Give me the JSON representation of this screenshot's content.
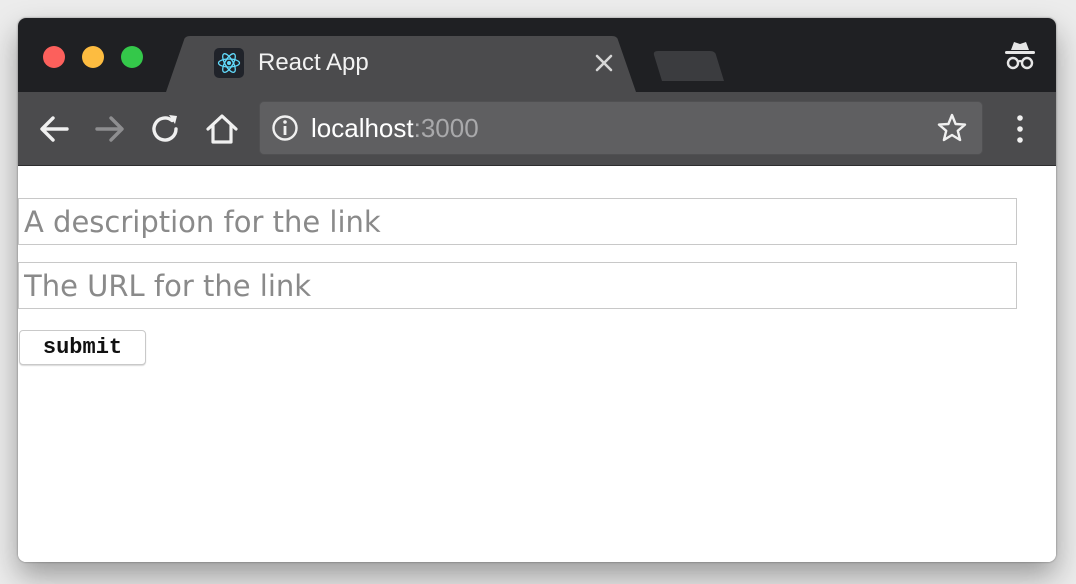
{
  "window": {
    "title": "React App"
  },
  "tabs": [
    {
      "label": "React App",
      "favicon": "react-logo-icon",
      "active": true
    }
  ],
  "toolbar": {
    "back": "back-arrow-icon",
    "forward": "forward-arrow-icon",
    "reload": "reload-icon",
    "home": "home-icon",
    "address": {
      "host": "localhost",
      "port": ":3000"
    },
    "bookmark": "star-icon",
    "menu": "menu-icon"
  },
  "form": {
    "description_placeholder": "A description for the link",
    "url_placeholder": "The URL for the link",
    "description_value": "",
    "url_value": "",
    "submit_label": "submit"
  },
  "colors": {
    "tabstrip": "#1f2023",
    "toolbar": "#4b4b4d",
    "active_tab": "#4b4b4d",
    "react_accent": "#61dafb"
  }
}
